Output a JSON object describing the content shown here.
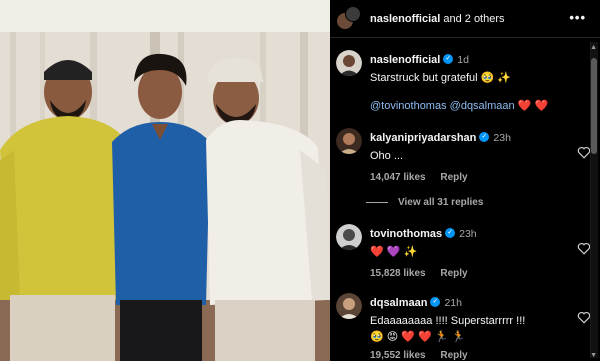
{
  "header": {
    "username": "naslenofficial",
    "coauthors": "and 2 others",
    "more_icon": "more-horizontal-icon"
  },
  "caption": {
    "username": "naslenofficial",
    "time": "1d",
    "text": "Starstruck but grateful 🥹 ✨",
    "mention1": "@tovinothomas",
    "mention2": "@dqsalmaan",
    "emojis": "❤️ ❤️"
  },
  "comments": [
    {
      "username": "kalyanipriyadarshan",
      "time": "23h",
      "text": "Oho ...",
      "likes": "14,047 likes",
      "reply": "Reply"
    },
    {
      "username": "tovinothomas",
      "time": "23h",
      "text": "❤️ 💜 ✨",
      "likes": "15,828 likes",
      "reply": "Reply"
    },
    {
      "username": "dqsalmaan",
      "time": "21h",
      "text": "Edaaaaaaaa !!!! Superstarrrrr !!!",
      "text2": "🥹 😡 ❤️ ❤️ 🏃 🏃",
      "likes": "19,552 likes",
      "reply": "Reply"
    }
  ],
  "view_all": "View all 31 replies",
  "colors": {
    "background": "#000000",
    "verified": "#0095f6",
    "mention": "#8fbcf2",
    "muted": "#a8a8a8"
  }
}
